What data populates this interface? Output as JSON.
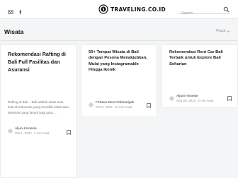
{
  "header": {
    "social_icons": [
      "email-icon",
      "facebook-icon"
    ],
    "logo_text": "TRAVELING.CO.ID",
    "search_placeholder": "Search ..."
  },
  "section": {
    "title": "Wisata",
    "sort_label": "Popul"
  },
  "posts": [
    {
      "title": "Rekomendasi Rafting di Bali Full Fasilitas dan Asuransi",
      "excerpt": "Rafting di Bali – Bali adalah salah satu kota di Indonesia yang memiliki salah satu destinasi yang favorit bagi para ...",
      "author": "Aljuni Hiroesie",
      "date": "Okt 1, 2022",
      "read_time": "1 min read"
    },
    {
      "title": "50+ Tempat Wisata di Bali dengan Pesona Menakjubkan, Mulai yang Instagramable Hingga Ikonik",
      "excerpt": "",
      "author": "Firdaus Dewi Febrianiyah",
      "date": "Okt 5, 2022",
      "read_time": "13 min read"
    },
    {
      "title": "Rekomendasi Rent Car Bali Terbaik untuk Explore Bali Seharian",
      "excerpt": "",
      "author": "Aljuni Hiroesie",
      "date": "Sep 26, 2022",
      "read_time": "2 min read"
    }
  ],
  "colors": {
    "background": "#f4f5f6",
    "card": "#ffffff",
    "title_text": "#1a1a1a",
    "meta_text": "#999999"
  }
}
